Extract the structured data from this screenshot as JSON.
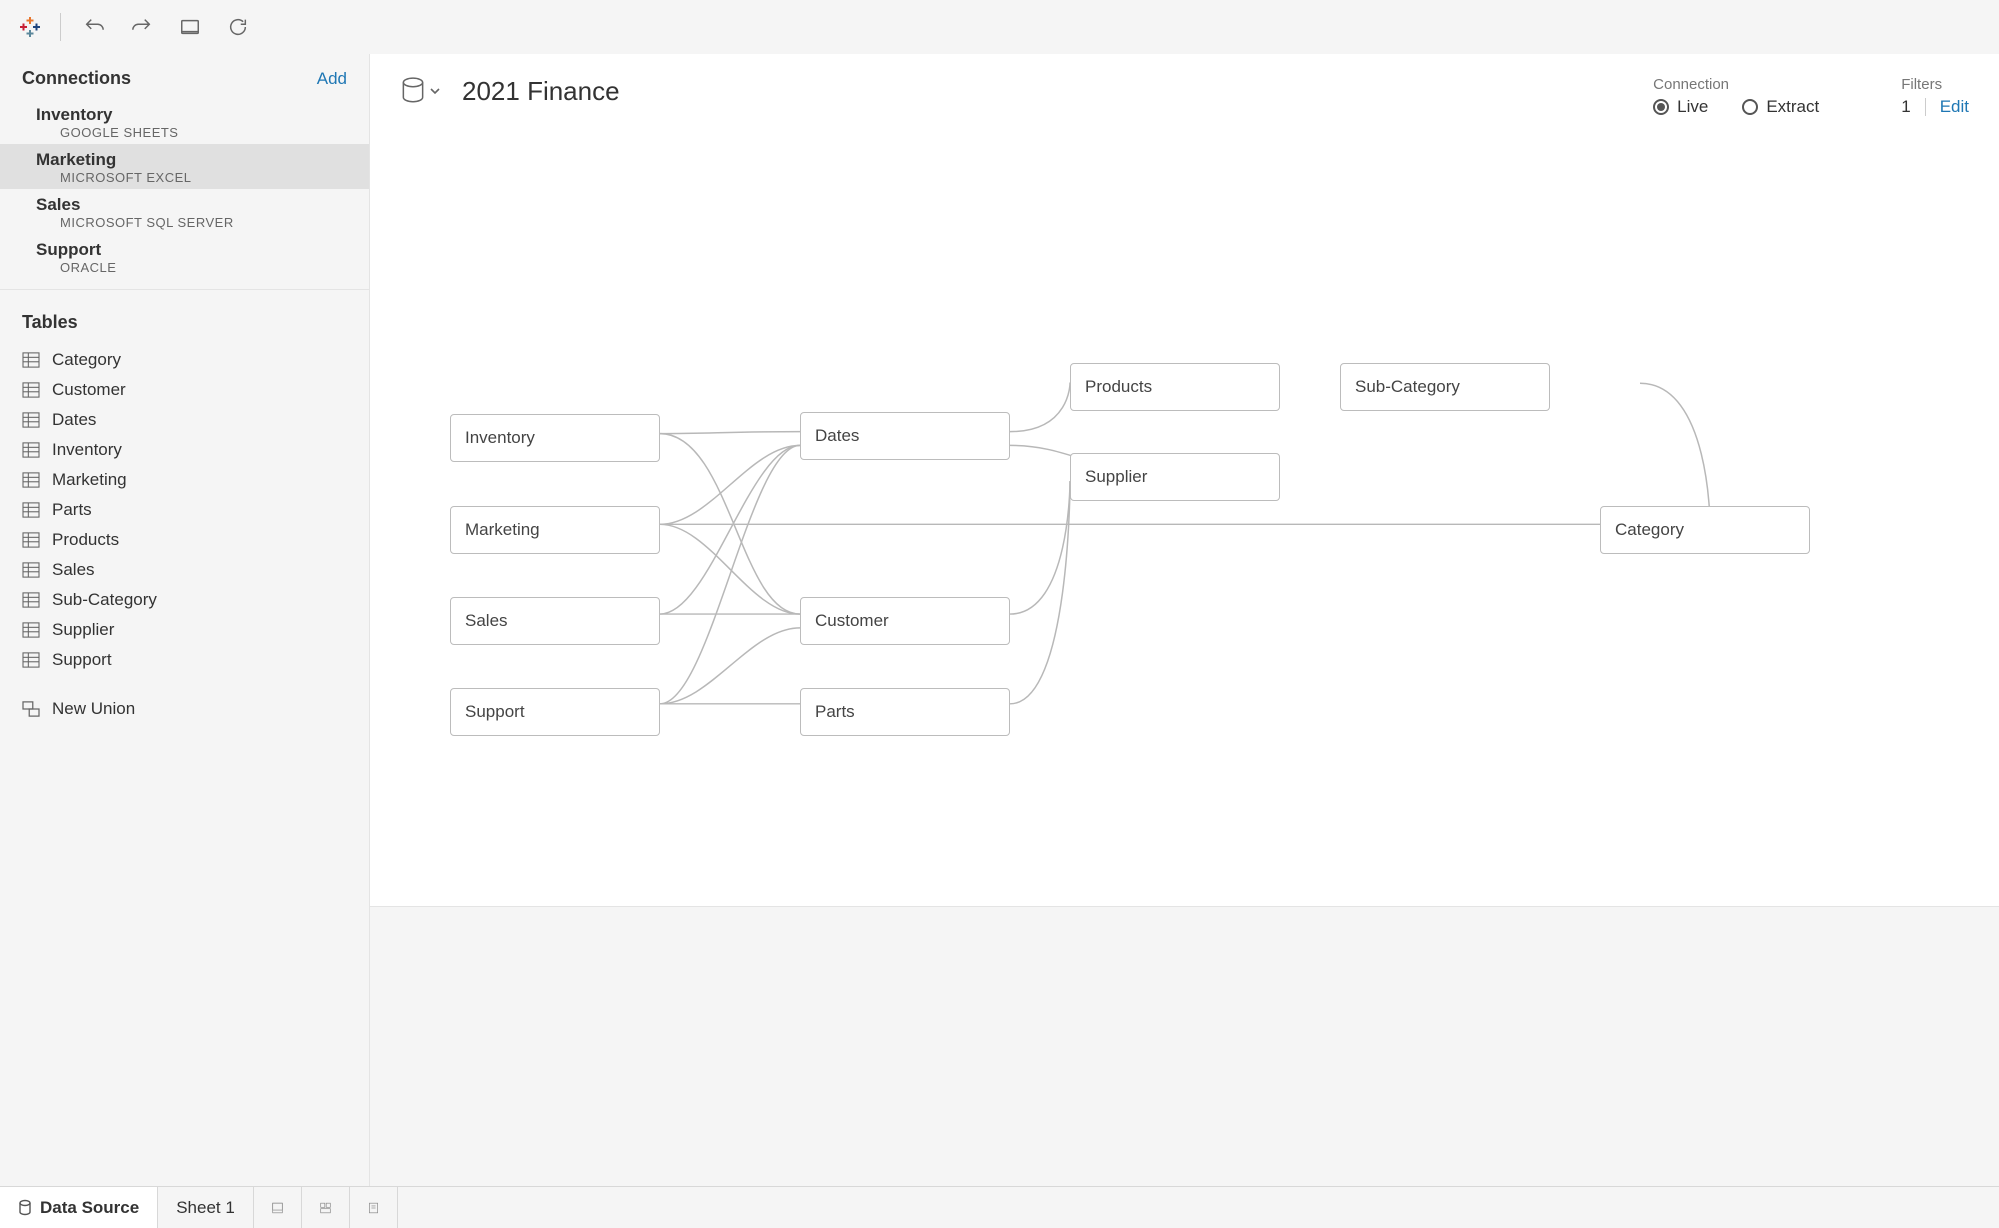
{
  "datasource_title": "2021 Finance",
  "sidebar": {
    "connections_label": "Connections",
    "add_label": "Add",
    "tables_label": "Tables",
    "new_union_label": "New Union",
    "connections": [
      {
        "name": "Inventory",
        "type": "GOOGLE SHEETS",
        "selected": false
      },
      {
        "name": "Marketing",
        "type": "MICROSOFT EXCEL",
        "selected": true
      },
      {
        "name": "Sales",
        "type": "MICROSOFT SQL SERVER",
        "selected": false
      },
      {
        "name": "Support",
        "type": "ORACLE",
        "selected": false
      }
    ],
    "tables": [
      "Category",
      "Customer",
      "Dates",
      "Inventory",
      "Marketing",
      "Parts",
      "Products",
      "Sales",
      "Sub-Category",
      "Supplier",
      "Support"
    ]
  },
  "connection_panel": {
    "label": "Connection",
    "live_label": "Live",
    "extract_label": "Extract",
    "mode": "live"
  },
  "filters_panel": {
    "label": "Filters",
    "count": "1",
    "edit_label": "Edit"
  },
  "canvas_nodes": {
    "inventory": "Inventory",
    "marketing": "Marketing",
    "sales": "Sales",
    "support": "Support",
    "dates": "Dates",
    "customer": "Customer",
    "parts": "Parts",
    "products": "Products",
    "supplier": "Supplier",
    "subcategory": "Sub-Category",
    "category": "Category"
  },
  "tabs": {
    "data_source": "Data Source",
    "sheet1": "Sheet 1"
  }
}
